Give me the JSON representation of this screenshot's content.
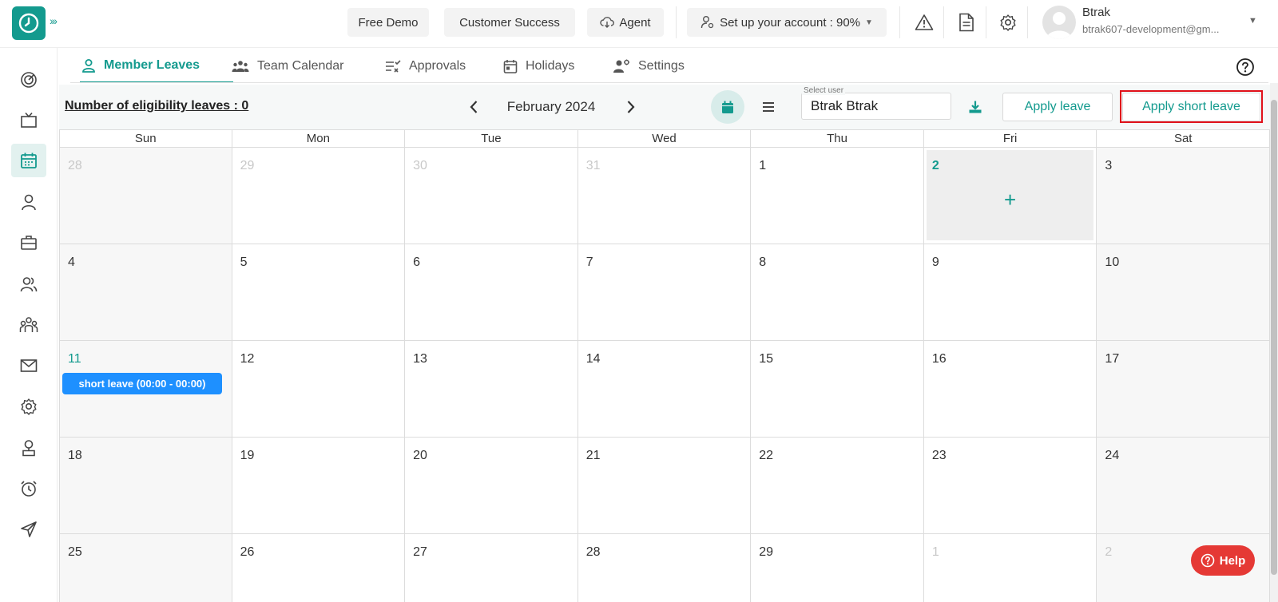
{
  "header": {
    "free_demo": "Free Demo",
    "customer_success": "Customer Success",
    "agent": "Agent",
    "setup": "Set up your account : 90%",
    "user_name": "Btrak",
    "user_email": "btrak607-development@gm..."
  },
  "tabs": [
    {
      "label": "Member Leaves",
      "icon": "person-icon"
    },
    {
      "label": "Team Calendar",
      "icon": "team-icon"
    },
    {
      "label": "Approvals",
      "icon": "approvals-icon"
    },
    {
      "label": "Holidays",
      "icon": "calendar-icon"
    },
    {
      "label": "Settings",
      "icon": "user-settings-icon"
    }
  ],
  "toolbar": {
    "eligibility": "Number of eligibility leaves : 0",
    "month": "February 2024",
    "select_user_label": "Select user",
    "select_user_value": "Btrak Btrak",
    "apply_leave": "Apply leave",
    "apply_short_leave": "Apply short leave"
  },
  "calendar": {
    "weekdays": [
      "Sun",
      "Mon",
      "Tue",
      "Wed",
      "Thu",
      "Fri",
      "Sat"
    ],
    "weeks": [
      [
        "28",
        "29",
        "30",
        "31",
        "1",
        "2",
        "3"
      ],
      [
        "4",
        "5",
        "6",
        "7",
        "8",
        "9",
        "10"
      ],
      [
        "11",
        "12",
        "13",
        "14",
        "15",
        "16",
        "17"
      ],
      [
        "18",
        "19",
        "20",
        "21",
        "22",
        "23",
        "24"
      ],
      [
        "25",
        "26",
        "27",
        "28",
        "29",
        "1",
        "2"
      ]
    ],
    "event": "short leave (00:00 - 00:00)"
  },
  "help": "Help",
  "colors": {
    "accent": "#139a8e",
    "event": "#1e90ff",
    "highlight": "#e0111a",
    "help": "#e53935"
  }
}
